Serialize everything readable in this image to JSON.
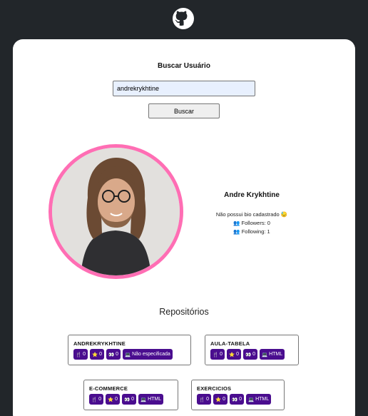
{
  "header": {
    "logo_icon": "github-icon"
  },
  "search": {
    "title": "Buscar Usuário",
    "input_value": "andrekrykhtine",
    "button_label": "Buscar"
  },
  "profile": {
    "name": "Andre Krykhtine",
    "bio": "Não possui bio cadastrado 😓",
    "followers": "👥 Followers: 0",
    "following": "👥 Following: 1",
    "avatar_border_color": "#ff6eb4"
  },
  "repositories": {
    "title": "Repositórios",
    "badge_color": "#4a0d8f",
    "items": [
      {
        "name": "ANDREKRYKHTINE",
        "forks": "0",
        "stars": "0",
        "watchers": "0",
        "language": "Não especificada"
      },
      {
        "name": "AULA-TABELA",
        "forks": "0",
        "stars": "0",
        "watchers": "0",
        "language": "HTML"
      },
      {
        "name": "E-COMMERCE",
        "forks": "0",
        "stars": "0",
        "watchers": "0",
        "language": "HTML"
      },
      {
        "name": "EXERCICIOS",
        "forks": "0",
        "stars": "0",
        "watchers": "0",
        "language": "HTML"
      }
    ]
  }
}
